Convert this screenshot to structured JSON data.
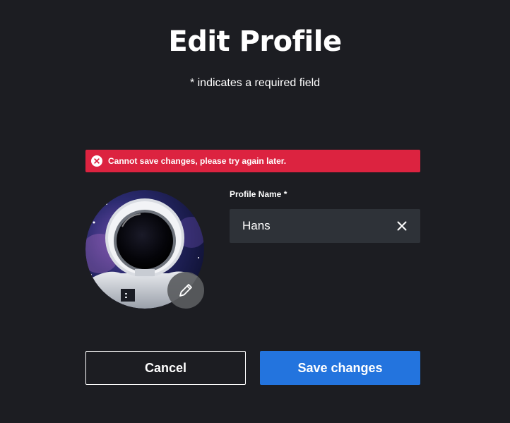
{
  "page": {
    "title": "Edit Profile",
    "required_note": "* indicates a required field"
  },
  "error": {
    "message": "Cannot save changes, please try again later.",
    "icon": "error-circle-x-icon",
    "color": "#dc2340"
  },
  "avatar": {
    "description_icon": "astronaut-avatar",
    "edit_icon": "pencil-icon"
  },
  "profile_name": {
    "label": "Profile Name *",
    "value": "Hans",
    "clear_icon": "close-icon"
  },
  "actions": {
    "cancel_label": "Cancel",
    "save_label": "Save changes",
    "save_color": "#2374de"
  },
  "colors": {
    "background": "#1c1d22",
    "input_background": "#2e3238"
  }
}
